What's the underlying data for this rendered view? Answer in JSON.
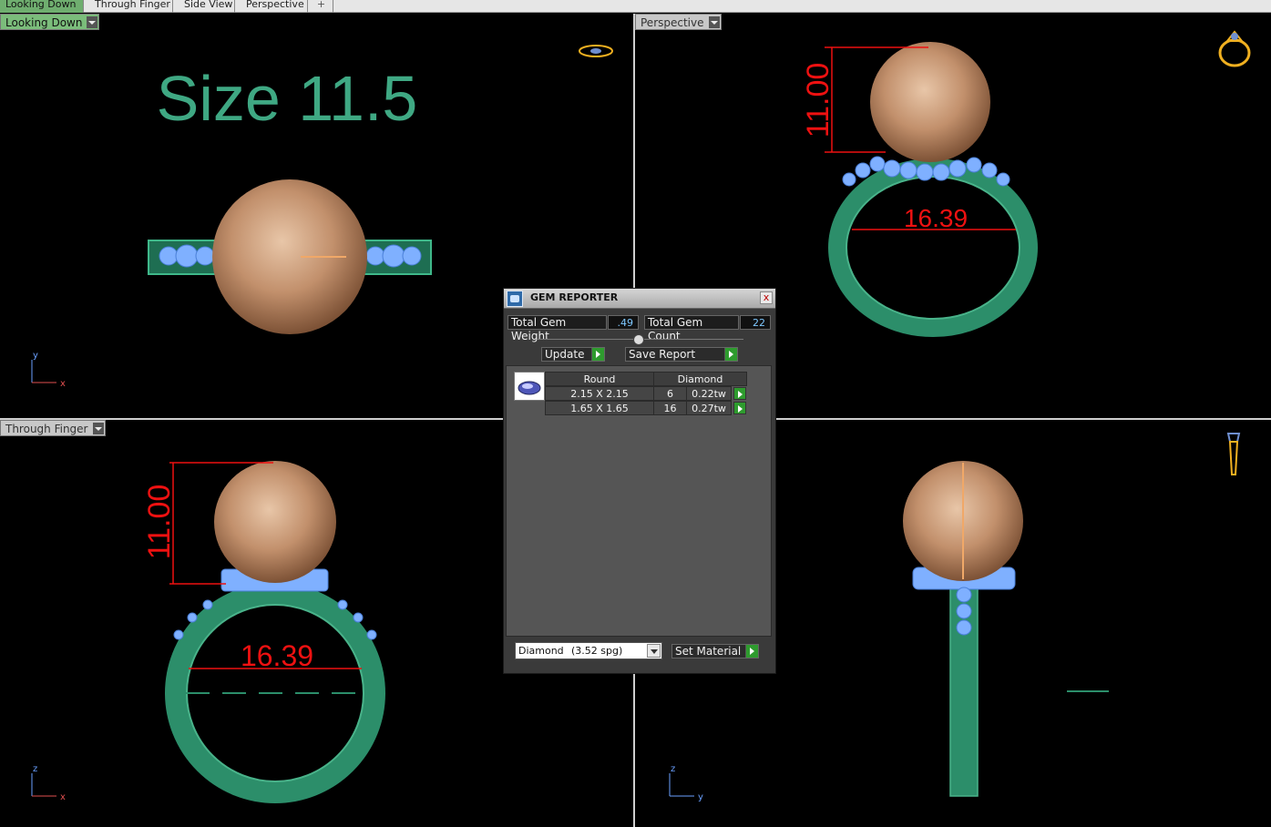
{
  "tabs": [
    {
      "label": "Looking Down",
      "active": true
    },
    {
      "label": "Through Finger",
      "active": false
    },
    {
      "label": "Side View",
      "active": false
    },
    {
      "label": "Perspective",
      "active": false
    }
  ],
  "tab_add_label": "+",
  "viewports": {
    "top_left": {
      "label": "Looking Down",
      "size_text": "Size 11.5",
      "axis_x": "x",
      "axis_y": "y"
    },
    "top_right": {
      "label": "Perspective",
      "height_dim": "11.00",
      "width_dim": "16.39"
    },
    "bottom_left": {
      "label": "Through Finger",
      "height_dim": "11.00",
      "width_dim": "16.39",
      "axis_x": "x",
      "axis_y": "z"
    },
    "bottom_right": {
      "axis_x": "y",
      "axis_y": "z"
    }
  },
  "colors": {
    "ring_green": "#2c8e6a",
    "gem_blue": "#7fb0ff",
    "pearl": "#c99b78",
    "dimension_red": "#e11",
    "text_green": "#3fa883",
    "gold_icon": "#f0b020"
  },
  "gem_reporter": {
    "title": "GEM REPORTER",
    "close_label": "x",
    "total_weight_label": "Total Gem Weight",
    "total_weight_value": ".49",
    "total_count_label": "Total Gem Count",
    "total_count_value": "22",
    "update_label": "Update",
    "save_report_label": "Save Report",
    "table": {
      "shape_header": "Round",
      "material_header": "Diamond",
      "rows": [
        {
          "size": "2.15 X 2.15",
          "count": "6",
          "weight": "0.22tw"
        },
        {
          "size": "1.65 X 1.65",
          "count": "16",
          "weight": "0.27tw"
        }
      ]
    },
    "material_select": {
      "name": "Diamond",
      "spg": "(3.52 spg)"
    },
    "set_material_label": "Set Material"
  }
}
